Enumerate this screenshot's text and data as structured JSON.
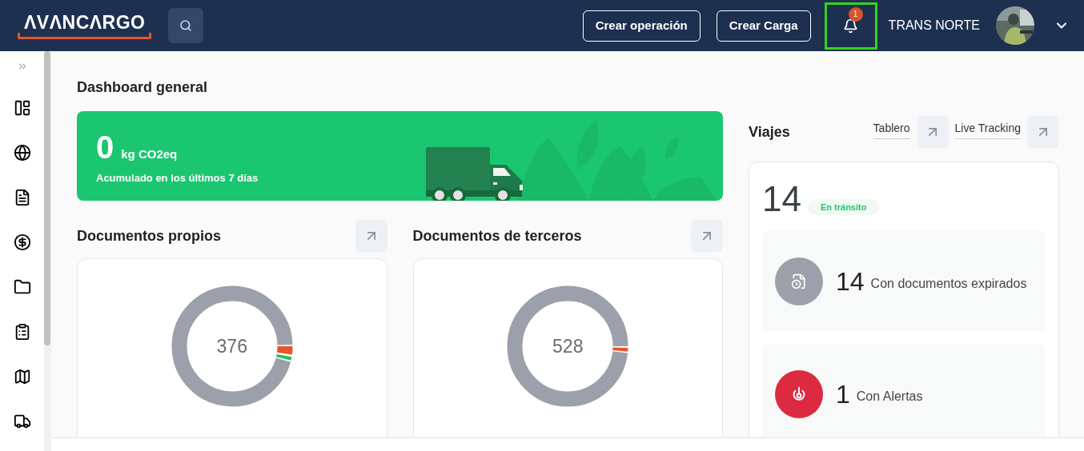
{
  "header": {
    "logo": "ΛVΛNCΛRGO",
    "buttons": [
      "Crear operación",
      "Crear Carga"
    ],
    "notifications": {
      "count": "1",
      "highlighted": true
    },
    "company": "TRANS NORTE"
  },
  "dashboard": {
    "title": "Dashboard general",
    "emissions": {
      "value": "0",
      "unit": "kg CO2eq",
      "caption": "Acumulado en los últimos 7 días"
    },
    "documents": [
      {
        "title": "Documentos propios",
        "total": "376"
      },
      {
        "title": "Documentos de terceros",
        "total": "528"
      }
    ]
  },
  "trips": {
    "title": "Viajes",
    "links": [
      "Tablero",
      "Live Tracking"
    ],
    "in_transit": {
      "count": "14",
      "label": "En tránsito"
    },
    "stats": [
      {
        "kind": "expired",
        "count": "14",
        "label": "Con documentos expirados"
      },
      {
        "kind": "alert",
        "count": "1",
        "label": "Con Alertas"
      }
    ]
  }
}
